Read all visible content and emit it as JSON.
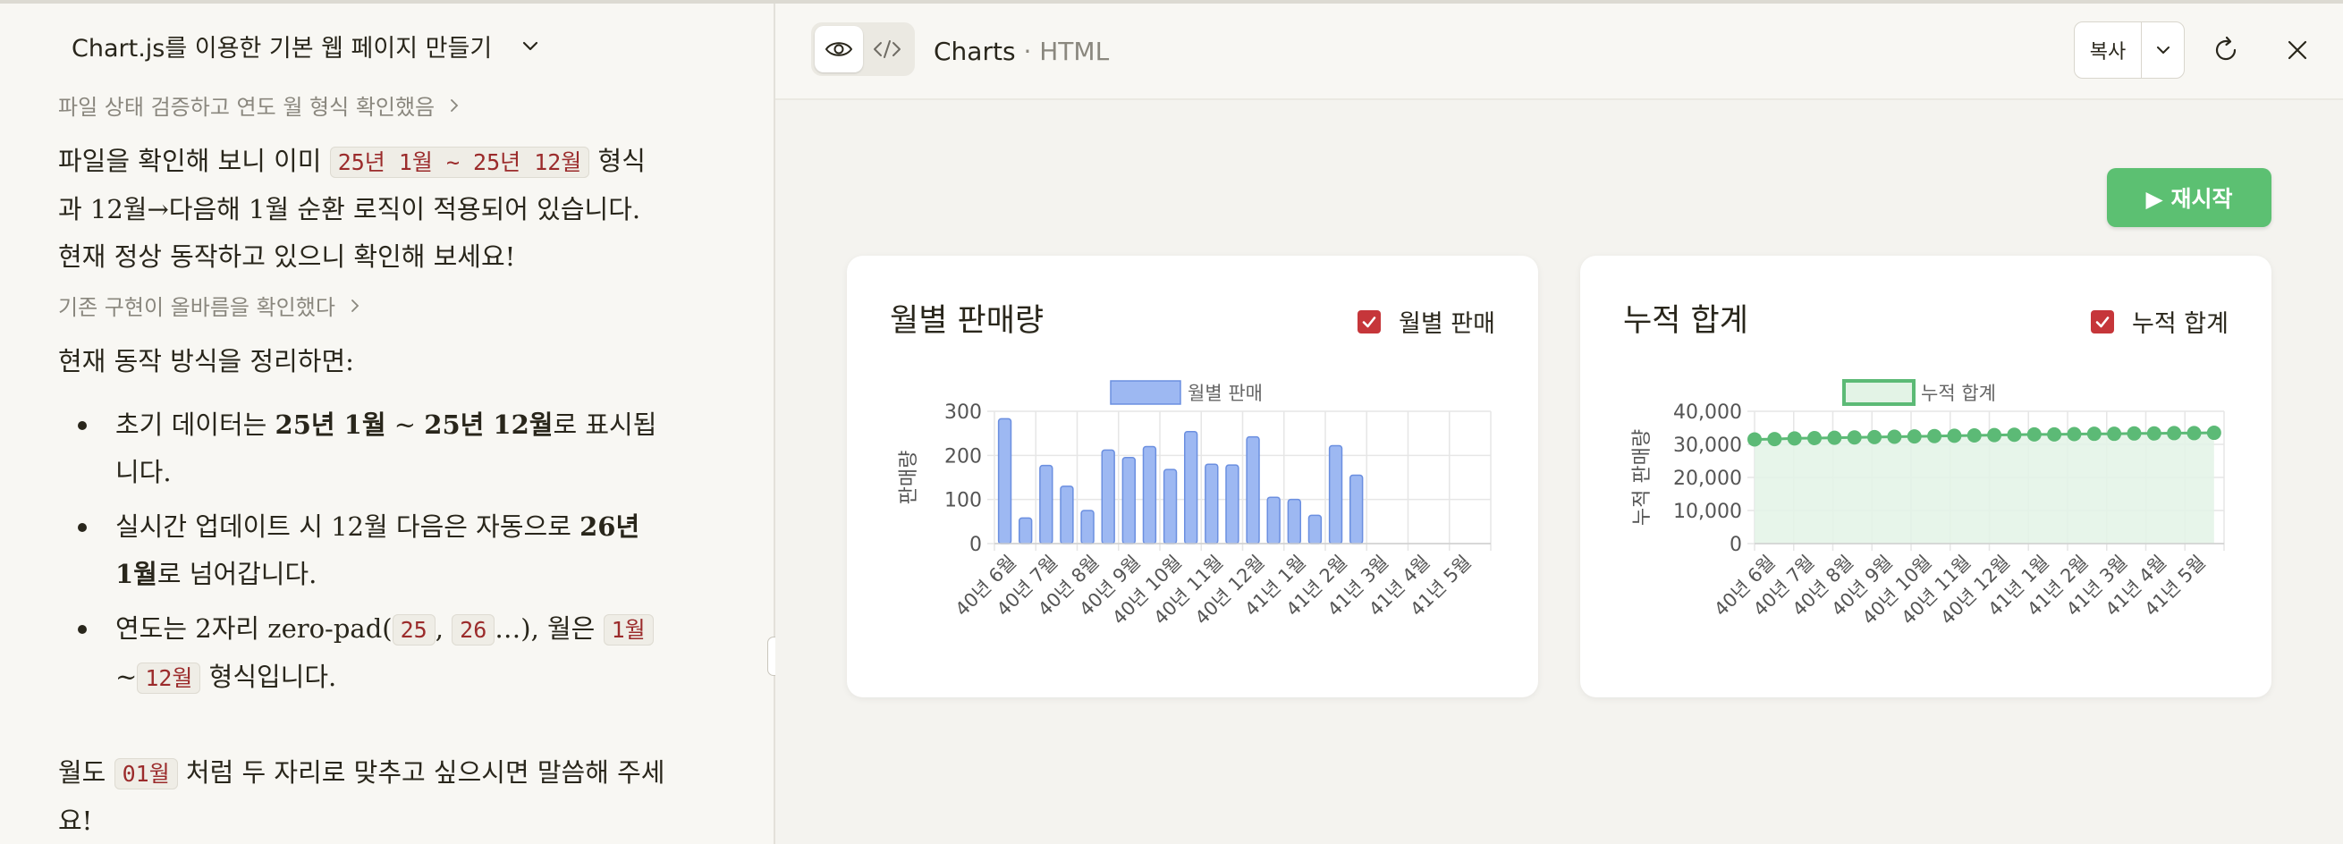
{
  "chat": {
    "title": "Chart.js를 이용한 기본 웹 페이지 만들기",
    "step1": "파일 상태 검증하고 연도 월 형식 확인했음",
    "para1": {
      "prefix": "파일을 확인해 보니 이미 ",
      "code": "25년 1월 ~ 25년 12월",
      "suffix": " 형식과 12월→다음해 1월 순환 로직이 적용되어 있습니다. 현재 정상 동작하고 있으니 확인해 보세요!"
    },
    "step2": "기존 구현이 올바름을 확인했다",
    "para2": "현재 동작 방식을 정리하면:",
    "bullet1": {
      "t1": "초기 데이터는 ",
      "b1": "25년 1월",
      "t2": " ~ ",
      "b2": "25년 12월",
      "t3": "로 표시됩니다."
    },
    "bullet2": {
      "t1": "실시간 업데이트 시 12월 다음은 자동으로 ",
      "b1": "26년 1월",
      "t2": "로 넘어갑니다."
    },
    "bullet3": {
      "t1": "연도는 2자리 zero-pad(",
      "c1": "25",
      "t2": ", ",
      "c2": "26",
      "t3": "…), 월은 ",
      "c3": "1월",
      "t4": "~",
      "c4": "12월",
      "t5": " 형식입니다."
    },
    "para3": {
      "t1": "월도 ",
      "code": "01월",
      "t2": " 처럼 두 자리로 맞추고 싶으시면 말씀해 주세요!"
    }
  },
  "artifact": {
    "title": "Charts",
    "subtitle": " · HTML",
    "copy_label": "복사",
    "restart_label": "▶ 재시작",
    "card1": {
      "title": "월별 판매량",
      "check_label": "월별 판매"
    },
    "card2": {
      "title": "누적 합계",
      "check_label": "누적 합계"
    }
  },
  "colors": {
    "bar_fill": "#9db8f2",
    "bar_stroke": "#6b8fe0",
    "line": "#5cba76",
    "area": "#e3f3e6",
    "restart": "#5cc072",
    "checkbox": "#c6363a"
  },
  "chart_data": [
    {
      "type": "bar",
      "legend": "월별 판매",
      "ylabel": "판매량",
      "yticks": [
        "300",
        "200",
        "100",
        "0"
      ],
      "ylim": [
        0,
        300
      ],
      "grid": true,
      "categories": [
        "40년 6월",
        "40년 7월",
        "40년 8월",
        "40년 9월",
        "40년 10월",
        "40년 11월",
        "40년 12월",
        "41년 1월",
        "41년 2월",
        "41년 3월",
        "41년 4월",
        "41년 5월"
      ],
      "values": [
        283,
        58,
        177,
        130,
        75,
        212,
        195,
        220,
        168,
        254,
        180,
        178,
        242,
        105,
        100,
        64,
        222,
        155
      ]
    },
    {
      "type": "area",
      "legend": "누적 합계",
      "ylabel": "누적 판매량",
      "yticks": [
        "40,000",
        "30,000",
        "20,000",
        "10,000",
        "0"
      ],
      "ylim": [
        0,
        40000
      ],
      "grid": true,
      "categories": [
        "40년 6월",
        "40년 7월",
        "40년 8월",
        "40년 9월",
        "40년 10월",
        "40년 11월",
        "40년 12월",
        "41년 1월",
        "41년 2월",
        "41년 3월",
        "41년 4월",
        "41년 5월"
      ],
      "values": [
        31500,
        31600,
        31800,
        31900,
        32000,
        32100,
        32200,
        32300,
        32400,
        32500,
        32600,
        32700,
        32800,
        32900,
        33000,
        33000,
        33100,
        33200,
        33200,
        33300,
        33300,
        33400,
        33400,
        33500
      ]
    }
  ]
}
